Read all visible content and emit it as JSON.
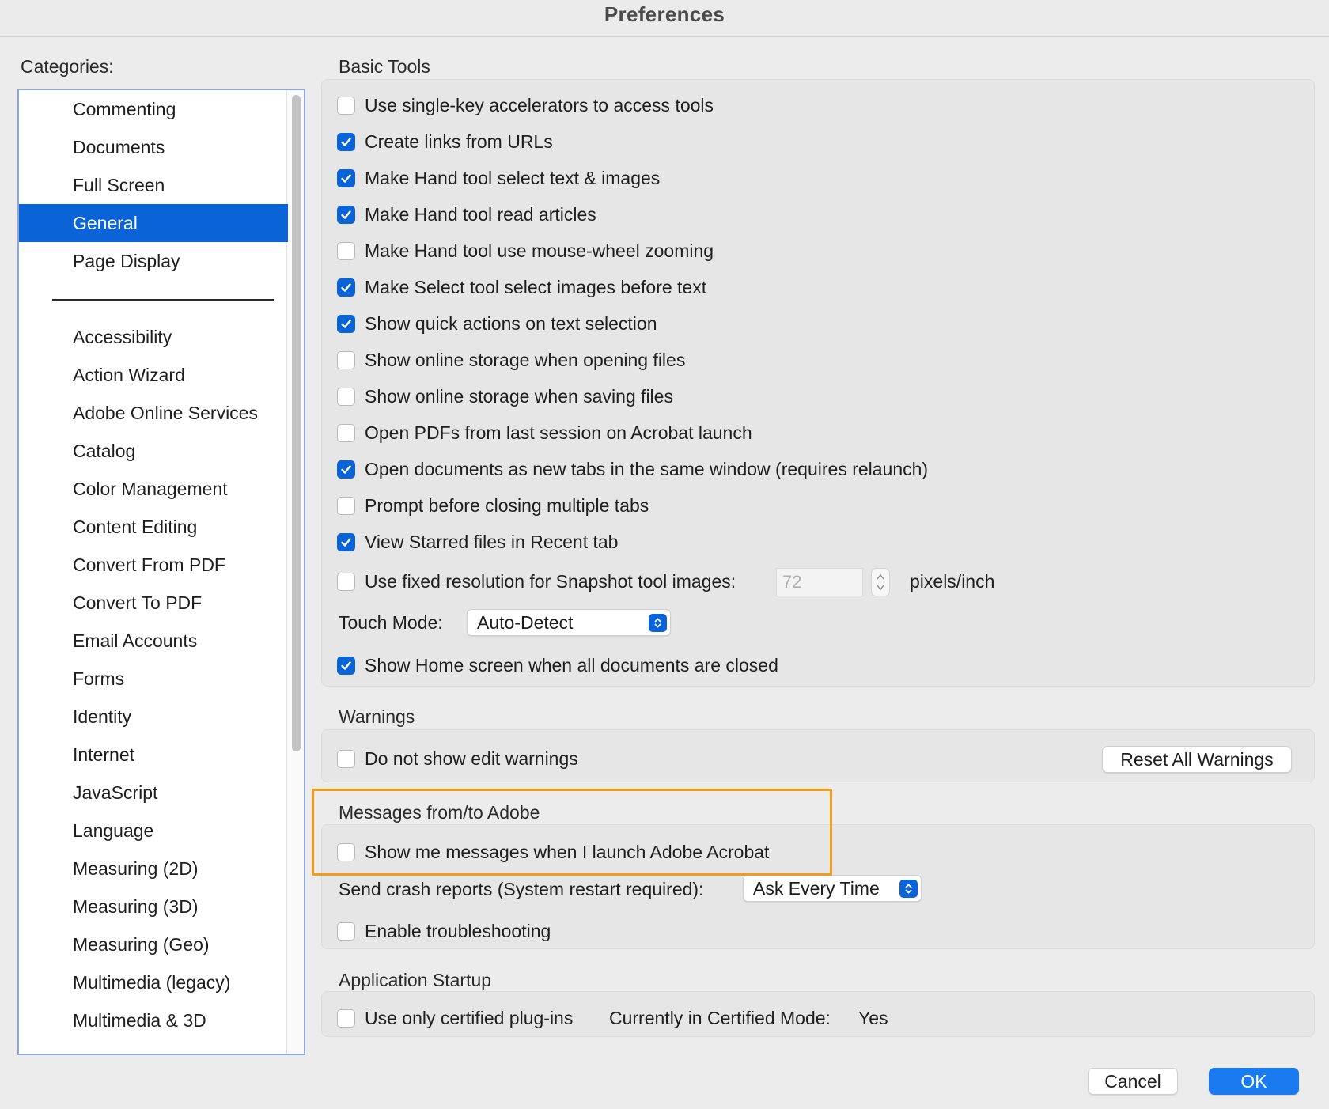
{
  "window": {
    "title": "Preferences"
  },
  "categories": {
    "label": "Categories:",
    "primary": [
      {
        "label": "Commenting",
        "selected": false
      },
      {
        "label": "Documents",
        "selected": false
      },
      {
        "label": "Full Screen",
        "selected": false
      },
      {
        "label": "General",
        "selected": true
      },
      {
        "label": "Page Display",
        "selected": false
      }
    ],
    "secondary": [
      "Accessibility",
      "Action Wizard",
      "Adobe Online Services",
      "Catalog",
      "Color Management",
      "Content Editing",
      "Convert From PDF",
      "Convert To PDF",
      "Email Accounts",
      "Forms",
      "Identity",
      "Internet",
      "JavaScript",
      "Language",
      "Measuring (2D)",
      "Measuring (3D)",
      "Measuring (Geo)",
      "Multimedia (legacy)",
      "Multimedia & 3D"
    ]
  },
  "basic_tools": {
    "title": "Basic Tools",
    "options": [
      {
        "label": "Use single-key accelerators to access tools",
        "checked": false
      },
      {
        "label": "Create links from URLs",
        "checked": true
      },
      {
        "label": "Make Hand tool select text & images",
        "checked": true
      },
      {
        "label": "Make Hand tool read articles",
        "checked": true
      },
      {
        "label": "Make Hand tool use mouse-wheel zooming",
        "checked": false
      },
      {
        "label": "Make Select tool select images before text",
        "checked": true
      },
      {
        "label": "Show quick actions on text selection",
        "checked": true
      },
      {
        "label": "Show online storage when opening files",
        "checked": false
      },
      {
        "label": "Show online storage when saving files",
        "checked": false
      },
      {
        "label": "Open PDFs from last session on Acrobat launch",
        "checked": false
      },
      {
        "label": "Open documents as new tabs in the same window (requires relaunch)",
        "checked": true
      },
      {
        "label": "Prompt before closing multiple tabs",
        "checked": false
      },
      {
        "label": "View Starred files in Recent tab",
        "checked": true
      }
    ],
    "snapshot": {
      "label": "Use fixed resolution for Snapshot tool images:",
      "checked": false,
      "value": "72",
      "unit": "pixels/inch"
    },
    "touch_mode": {
      "label": "Touch Mode:",
      "value": "Auto-Detect"
    },
    "home_screen": {
      "label": "Show Home screen when all documents are closed",
      "checked": true
    }
  },
  "warnings": {
    "title": "Warnings",
    "option": {
      "label": "Do not show edit warnings",
      "checked": false
    },
    "reset_button": "Reset All Warnings"
  },
  "messages": {
    "title": "Messages from/to Adobe",
    "option": {
      "label": "Show me messages when I launch Adobe Acrobat",
      "checked": false
    },
    "crash_reports": {
      "label": "Send crash reports (System restart required):",
      "value": "Ask Every Time"
    },
    "troubleshooting": {
      "label": "Enable troubleshooting",
      "checked": false
    }
  },
  "startup": {
    "title": "Application Startup",
    "option": {
      "label": "Use only certified plug-ins",
      "checked": false
    },
    "certified_mode_label": "Currently in Certified Mode:",
    "certified_mode_value": "Yes"
  },
  "footer": {
    "cancel": "Cancel",
    "ok": "OK"
  },
  "colors": {
    "accent": "#0a64d8",
    "highlight": "#f39c1a"
  }
}
